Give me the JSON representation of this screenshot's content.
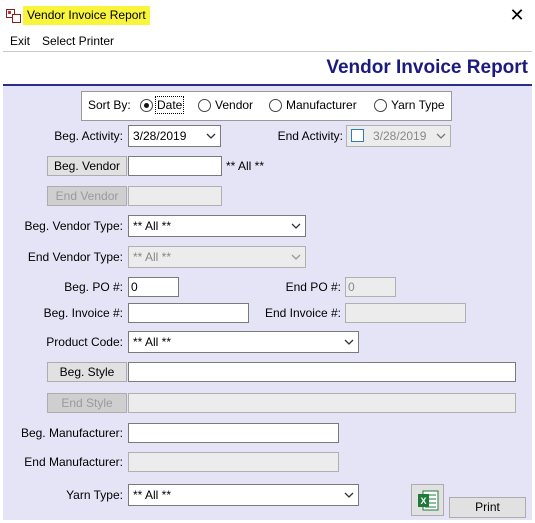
{
  "window": {
    "title": "Vendor Invoice Report",
    "close_glyph": "✕"
  },
  "menu": {
    "exit": "Exit",
    "select_printer": "Select Printer"
  },
  "header": {
    "title": "Vendor Invoice Report"
  },
  "sort": {
    "label": "Sort By:",
    "options": [
      "Date",
      "Vendor",
      "Manufacturer",
      "Yarn Type"
    ],
    "selected": "Date"
  },
  "form": {
    "beg_activity_label": "Beg. Activity:",
    "beg_activity_value": "3/28/2019",
    "end_activity_label": "End Activity:",
    "end_activity_value": "3/28/2019",
    "beg_vendor_button": "Beg. Vendor",
    "beg_vendor_value": "",
    "all_note": "** All **",
    "end_vendor_button": "End Vendor",
    "end_vendor_value": "",
    "beg_vendor_type_label": "Beg. Vendor Type:",
    "beg_vendor_type_value": "** All **",
    "end_vendor_type_label": "End Vendor Type:",
    "end_vendor_type_value": "** All **",
    "beg_po_label": "Beg. PO #:",
    "beg_po_value": "0",
    "end_po_label": "End PO #:",
    "end_po_value": "0",
    "beg_invoice_label": "Beg. Invoice #:",
    "beg_invoice_value": "",
    "end_invoice_label": "End Invoice #:",
    "end_invoice_value": "",
    "product_code_label": "Product Code:",
    "product_code_value": "** All **",
    "beg_style_button": "Beg. Style",
    "beg_style_value": "",
    "end_style_button": "End Style",
    "end_style_value": "",
    "beg_manufacturer_label": "Beg. Manufacturer:",
    "beg_manufacturer_value": "",
    "end_manufacturer_label": "End Manufacturer:",
    "end_manufacturer_value": "",
    "yarn_type_label": "Yarn Type:",
    "yarn_type_value": "** All **"
  },
  "actions": {
    "print": "Print",
    "excel_icon": "excel-export-icon"
  },
  "colors": {
    "heading": "#1b1b7f",
    "panel": "#e5e4f6",
    "title_highlight": "#f8f53a",
    "divider": "#2c2c8c"
  }
}
